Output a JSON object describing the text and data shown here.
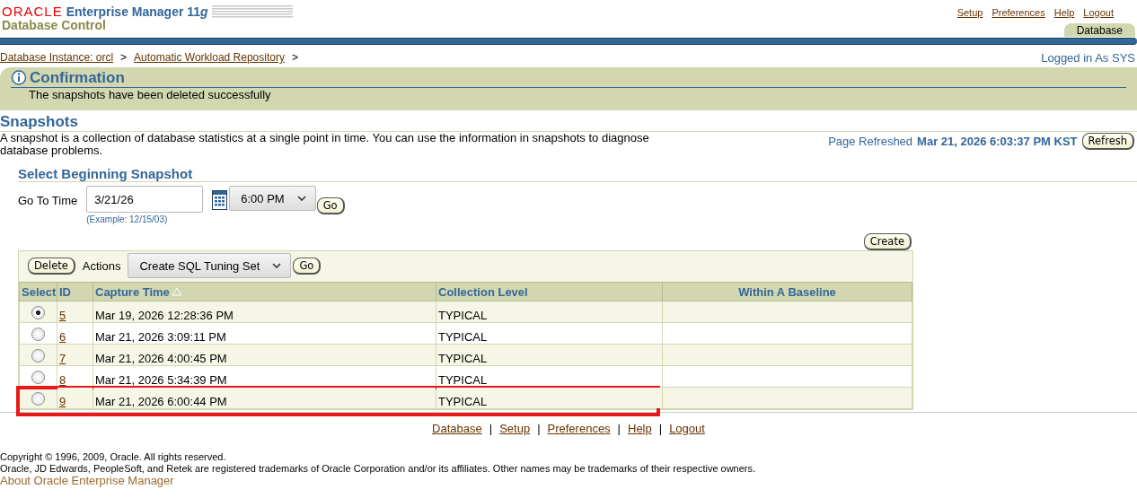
{
  "branding": {
    "company": "ORACLE",
    "product": "Enterprise Manager 11",
    "version_letter": "g",
    "subtitle": "Database Control"
  },
  "global_links": [
    "Setup",
    "Preferences",
    "Help",
    "Logout"
  ],
  "tabs": [
    {
      "label": "Database",
      "selected": true
    }
  ],
  "breadcrumbs": [
    "Database Instance: orcl",
    "Automatic Workload Repository"
  ],
  "breadcrumb_separator": ">",
  "user": "Logged in As SYS",
  "confirmation": {
    "title": "Confirmation",
    "message": "The snapshots have been deleted successfully"
  },
  "page": {
    "title": "Snapshots",
    "description": "A snapshot is a collection of database statistics at a single point in time. You can use the information in snapshots to diagnose database problems.",
    "refreshed_label": "Page Refreshed",
    "refreshed_value": "Mar 21, 2026 6:03:37 PM KST",
    "refresh_button": "Refresh"
  },
  "beginning": {
    "title": "Select Beginning Snapshot",
    "label": "Go To Time",
    "date_value": "3/21/26",
    "example": "(Example: 12/15/03)",
    "time_value": "6:00 PM",
    "go": "Go"
  },
  "create_button": "Create",
  "actions": {
    "delete": "Delete",
    "label": "Actions",
    "selected_action": "Create SQL Tuning Set",
    "go": "Go"
  },
  "table": {
    "columns": [
      {
        "label": "Select",
        "sorted": false
      },
      {
        "label": "ID",
        "sorted": false
      },
      {
        "label": "Capture Time",
        "sorted": true
      },
      {
        "label": "Collection Level",
        "sorted": false
      },
      {
        "label": "Within A Baseline",
        "sorted": false
      }
    ],
    "rows": [
      {
        "selected": true,
        "highlighted": false,
        "id": "5",
        "capture_time": "Mar 19, 2026 12:28:36 PM",
        "level": "TYPICAL"
      },
      {
        "selected": false,
        "highlighted": false,
        "id": "6",
        "capture_time": "Mar 21, 2026 3:09:11 PM",
        "level": "TYPICAL"
      },
      {
        "selected": false,
        "highlighted": false,
        "id": "7",
        "capture_time": "Mar 21, 2026 4:00:45 PM",
        "level": "TYPICAL"
      },
      {
        "selected": false,
        "highlighted": false,
        "id": "8",
        "capture_time": "Mar 21, 2026 5:34:39 PM",
        "level": "TYPICAL"
      },
      {
        "selected": false,
        "highlighted": true,
        "id": "9",
        "capture_time": "Mar 21, 2026 6:00:44 PM",
        "level": "TYPICAL"
      }
    ]
  },
  "footer_links": [
    "Database",
    "Setup",
    "Preferences",
    "Help",
    "Logout"
  ],
  "footer_separator": "|",
  "copyright": [
    "Copyright © 1996, 2009, Oracle. All rights reserved.",
    "Oracle, JD Edwards, PeopleSoft, and Retek are registered trademarks of Oracle Corporation and/or its affiliates. Other names may be trademarks of their respective owners."
  ],
  "about_link": "About Oracle Enterprise Manager"
}
